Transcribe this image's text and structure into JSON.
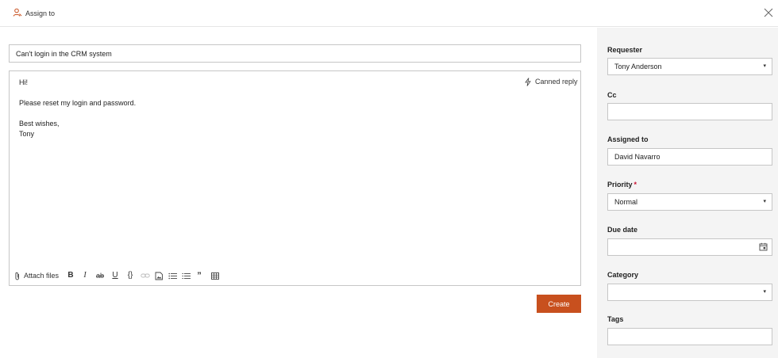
{
  "header": {
    "title": "Assign to",
    "icon": "assign-user-icon"
  },
  "form": {
    "subject_value": "Can't login in the CRM system",
    "body_lines": [
      "Hi!",
      "",
      "Please reset my login and password.",
      "",
      "Best wishes,",
      "Tony"
    ],
    "canned_reply_label": "Canned reply",
    "attach_label": "Attach files",
    "toolbar": {
      "bold": "B",
      "italic": "I",
      "strike": "ab",
      "underline": "U",
      "code": "{}",
      "quote": "”"
    },
    "create_label": "Create"
  },
  "sidebar": {
    "requester": {
      "label": "Requester",
      "value": "Tony Anderson"
    },
    "cc": {
      "label": "Cc",
      "value": ""
    },
    "assigned_to": {
      "label": "Assigned to",
      "value": "David Navarro"
    },
    "priority": {
      "label": "Priority",
      "required_mark": "*",
      "value": "Normal"
    },
    "due_date": {
      "label": "Due date",
      "value": ""
    },
    "category": {
      "label": "Category",
      "value": ""
    },
    "tags": {
      "label": "Tags",
      "value": ""
    },
    "caret": "▾"
  },
  "colors": {
    "accent": "#c8501e",
    "required": "#c8102e",
    "panel_bg": "#f4f4f4",
    "border": "#c6c6c6"
  }
}
